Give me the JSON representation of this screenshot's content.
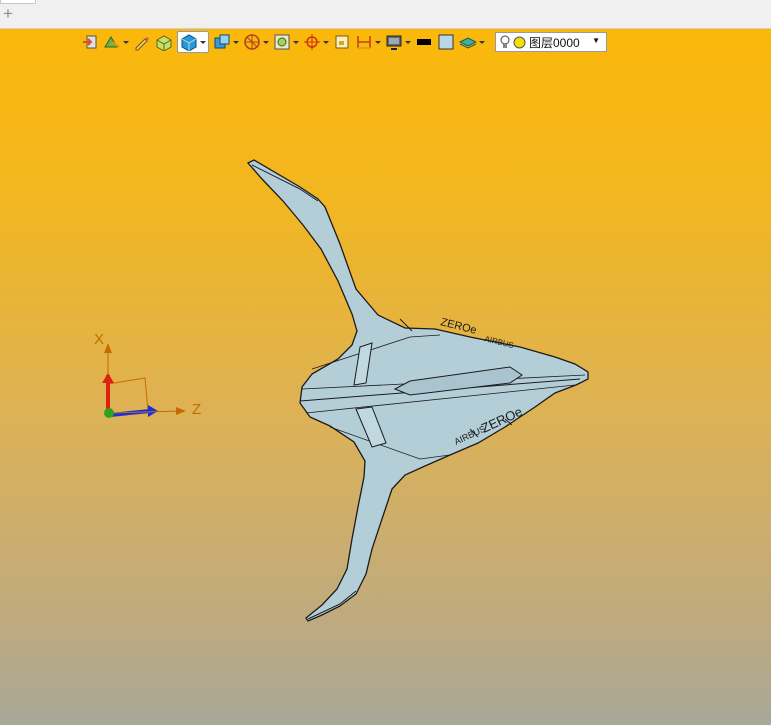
{
  "tabbar": {
    "new_tab_glyph": "+"
  },
  "toolbar": {
    "icons": [
      "exit-icon",
      "render-style-icon",
      "sketch-pen-icon",
      "box-icon",
      "shaded-cube-icon",
      "view-cube-icon",
      "section-view-icon",
      "zoom-fit-icon",
      "snap-target-icon",
      "frame-icon",
      "dimension-icon",
      "monitor-icon",
      "black-line-swatch",
      "light-blue-swatch",
      "layer-stack-icon"
    ],
    "layer": {
      "name": "图层0000",
      "icons": [
        "lightbulb-icon",
        "yellow-circle-icon"
      ]
    }
  },
  "viewport": {
    "gradient_top": "#fbb80a",
    "gradient_bottom": "#a8a798",
    "axes": {
      "x_label": "X",
      "z_label": "Z"
    },
    "model": {
      "lettering": [
        "ZEROe",
        "AIRBUS",
        "ZEROe",
        "AIRBUS"
      ],
      "body_color": "#b4ced8"
    }
  }
}
